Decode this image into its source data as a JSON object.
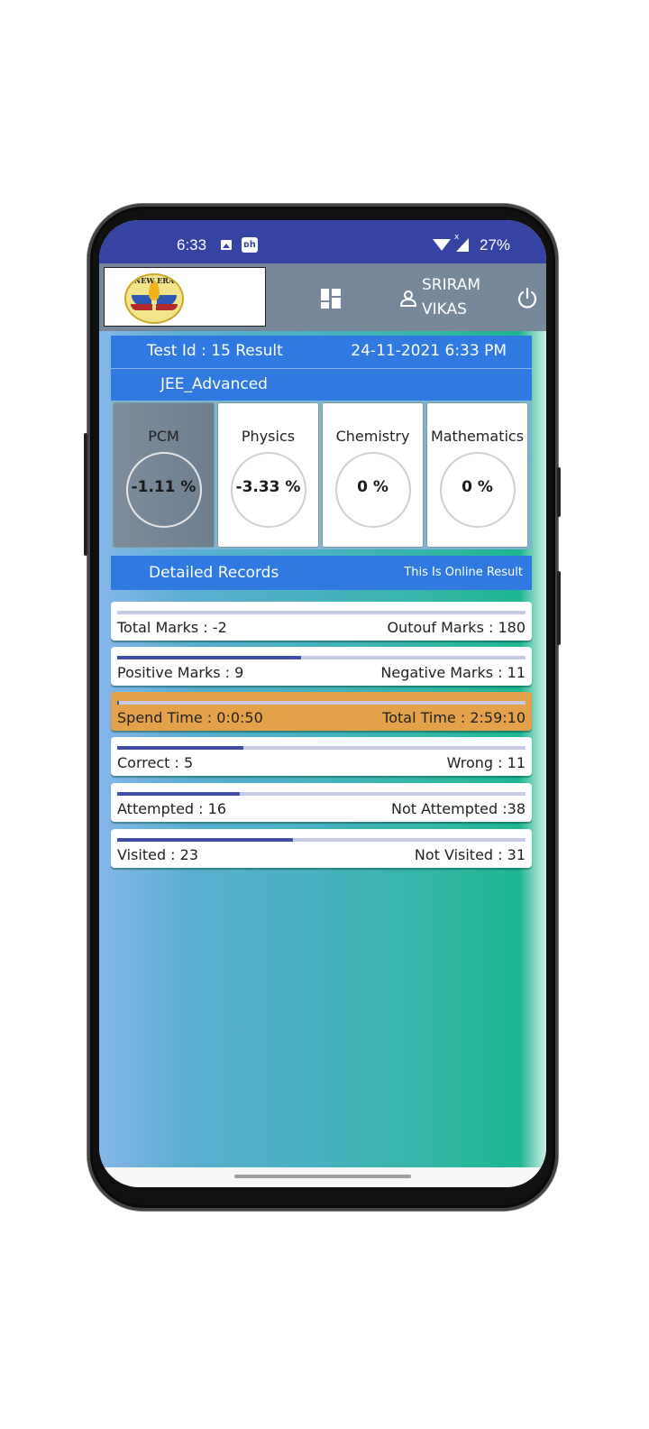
{
  "status_bar": {
    "time": "6:33",
    "notification_icons": [
      "image-icon",
      "app-notification-icon"
    ],
    "app_icon_glyph": "ᴅh",
    "signal_label": "x",
    "battery": "27%"
  },
  "top_bar": {
    "logo_text": "NEW ERA",
    "dashboard_icon": "grid-icon",
    "user_name_line1": "SRIRAM",
    "user_name_line2": "VIKAS",
    "logout_icon": "power-icon"
  },
  "result_header": {
    "test_id": "Test Id : 15 Result",
    "datetime": "24-11-2021 6:33 PM",
    "exam_name": "JEE_Advanced"
  },
  "subjects": [
    {
      "name": "PCM",
      "value": "-1.11 %",
      "selected": true
    },
    {
      "name": "Physics",
      "value": "-3.33 %",
      "selected": false
    },
    {
      "name": "Chemistry",
      "value": "0 %",
      "selected": false
    },
    {
      "name": "Mathematics",
      "value": "0 %",
      "selected": false
    }
  ],
  "detailed_records": {
    "title": "Detailed Records",
    "note": "This Is Online Result",
    "rows": [
      {
        "left": "Total Marks : -2",
        "right": "Outouf Marks : 180",
        "progress": 0.0,
        "highlight": false
      },
      {
        "left": "Positive Marks : 9",
        "right": "Negative Marks : 11",
        "progress": 0.45,
        "highlight": false
      },
      {
        "left": "Spend Time : 0:0:50",
        "right": "Total Time : 2:59:10",
        "progress": 0.005,
        "highlight": true
      },
      {
        "left": "Correct : 5",
        "right": "Wrong : 11",
        "progress": 0.31,
        "highlight": false
      },
      {
        "left": "Attempted : 16",
        "right": "Not Attempted :38",
        "progress": 0.3,
        "highlight": false
      },
      {
        "left": "Visited : 23",
        "right": "Not Visited : 31",
        "progress": 0.43,
        "highlight": false
      }
    ]
  },
  "colors": {
    "status_bar": "#3543a3",
    "top_bar": "#76889a",
    "header_blue": "#2f79e0",
    "progress_fill": "#3f4fa8",
    "progress_track": "#c8cbe6",
    "highlight_row": "#e3a24a"
  }
}
